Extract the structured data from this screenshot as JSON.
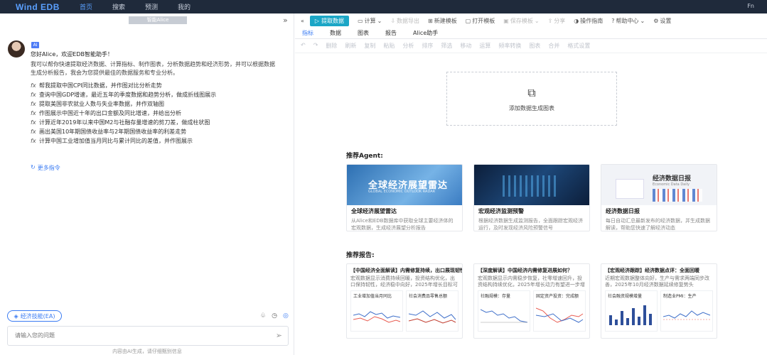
{
  "topbar": {
    "logo": "Wind EDB",
    "nav": [
      "首页",
      "搜索",
      "预测",
      "我的"
    ],
    "active_index": 0,
    "user": "Fn"
  },
  "left": {
    "session_tag": "智能Alice",
    "badge": "AI",
    "greeting": "您好Alice，欢迎EDB智能助手！",
    "intro": "我可以帮你快速提取经济数据、计算指标、制作图表，分析数据趋势和经济形势，并可以根据数据生成分析报告，我会为您提供最佳的数据服务和专业分析。",
    "suggestions": [
      "帮我提取中国CPI同比数据，并作图对比分析走势",
      "查询中国GDP增速，最近五年的季度数据和趋势分析，做成折线图展示",
      "提取美国非农就业人数与失业率数据，并作双轴图",
      "作图展示中国近十年的出口金额及同比增速，并给出分析",
      "计算近年2019年以来中国M2与社融存量增速的剪刀差，做成柱状图",
      "画出美国10年期国债收益率与2年期国债收益率的利差走势",
      "计算中国工业增加值当月同比与累计同比的差值，并作图展示"
    ],
    "more_link": "更多指令",
    "skill_button": "经济技能(EA)",
    "input_placeholder": "请输入您的问题",
    "disclaimer": "内容由AI生成，请仔细甄别信息"
  },
  "right": {
    "toolbar": {
      "extract": "提取数据",
      "items": [
        "计算",
        "数据导出",
        "新建模板",
        "打开模板",
        "保存模板",
        "分享",
        "操作指南",
        "帮助中心",
        "设置"
      ]
    },
    "tabs": [
      "指标",
      "数据",
      "图表",
      "报告",
      "Alice助手"
    ],
    "active_tab": 0,
    "subtools": [
      "撤销",
      "重做",
      "删除",
      "刷新",
      "复制",
      "粘贴",
      "分析",
      "排序",
      "筛选",
      "移动",
      "运算",
      "频率转换",
      "图表",
      "合并",
      "格式设置"
    ],
    "add_chart": "添加数据生成图表",
    "agent_section": "推荐Agent:",
    "agents": [
      {
        "img_title": "全球经济展望雷达",
        "img_sub": "GLOBAL ECONOMIC OUTLOOK RADAR",
        "title": "全球经济展望雷达",
        "desc": "从Alice和EDB数据库中获取全球主要经济体的宏观数据，生成经济展望分析报告"
      },
      {
        "img_title": "",
        "img_sub": "",
        "title": "宏观经济监测预警",
        "desc": "根据经济数据生成监测报告，全面跟踪宏观经济运行，及时发现经济风险预警信号"
      },
      {
        "img_title": "经济数据日报",
        "img_sub": "Economic Data Daily",
        "title": "经济数据日报",
        "desc": "每日自动汇总最新发布的经济数据，并生成数据解读，帮助您快速了解经济动态"
      }
    ],
    "report_section": "推荐报告:",
    "reports": [
      {
        "title": "【中国经济全面解读】内需修复持续，出口展现韧性",
        "desc": "宏观数据显示消费持续回暖，投资结构优化，出口保持韧性，经济稳中向好，2025年增长目标可期",
        "charts": [
          "工业增加值当月同比",
          "社会消费品零售总额"
        ]
      },
      {
        "title": "【深度解读】中国经济内需修复进展如何？",
        "desc": "宏观数据显示内需稳步恢复，社零增速回升，投资结构持续优化，2025年增长动力有望进一步增强",
        "charts": [
          "社融规模：存量",
          "固定资产投资：完成额"
        ]
      },
      {
        "title": "【宏观经济跟踪】经济数据点评：全面回暖",
        "desc": "近期宏观数据整体向好，生产与需求两端同步改善，2025年10月经济数据延续修复势头",
        "charts": [
          "社会融资规模增量",
          "制造业PMI：生产"
        ]
      }
    ]
  }
}
